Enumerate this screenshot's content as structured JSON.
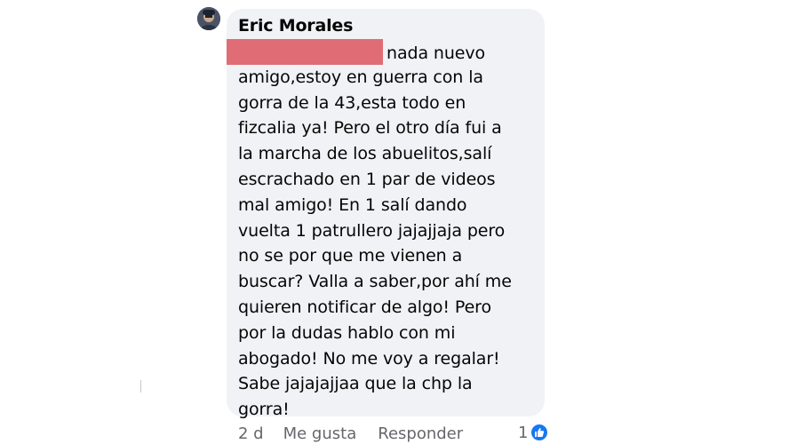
{
  "comment": {
    "author": "Eric Morales",
    "lines": [
      "nada nuevo",
      "amigo,estoy en guerra con la",
      "gorra de la 43,esta todo en",
      "fizcalia ya! Pero el otro día fui a",
      "la marcha de los abuelitos,salí",
      "escrachado en 1 par de videos",
      "mal amigo! En 1 salí dando",
      "vuelta 1 patrullero jajajjaja pero",
      "no se por que me vienen a",
      "buscar? Valla a saber,por ahí me",
      "quieren notificar de algo! Pero",
      "por la dudas hablo con mi",
      "abogado! No me voy a regalar!",
      "Sabe jajajajjaa que la chp la",
      "gorra!"
    ]
  },
  "actions": {
    "time": "2 d",
    "like_label": "Me gusta",
    "reply_label": "Responder"
  },
  "reactions": {
    "count": "1",
    "icon": "thumbs-up-icon",
    "badge_color": "#1877f2"
  },
  "colors": {
    "bubble": "#f0f2f5",
    "redaction": "#e06c75",
    "meta_text": "#65676b"
  }
}
